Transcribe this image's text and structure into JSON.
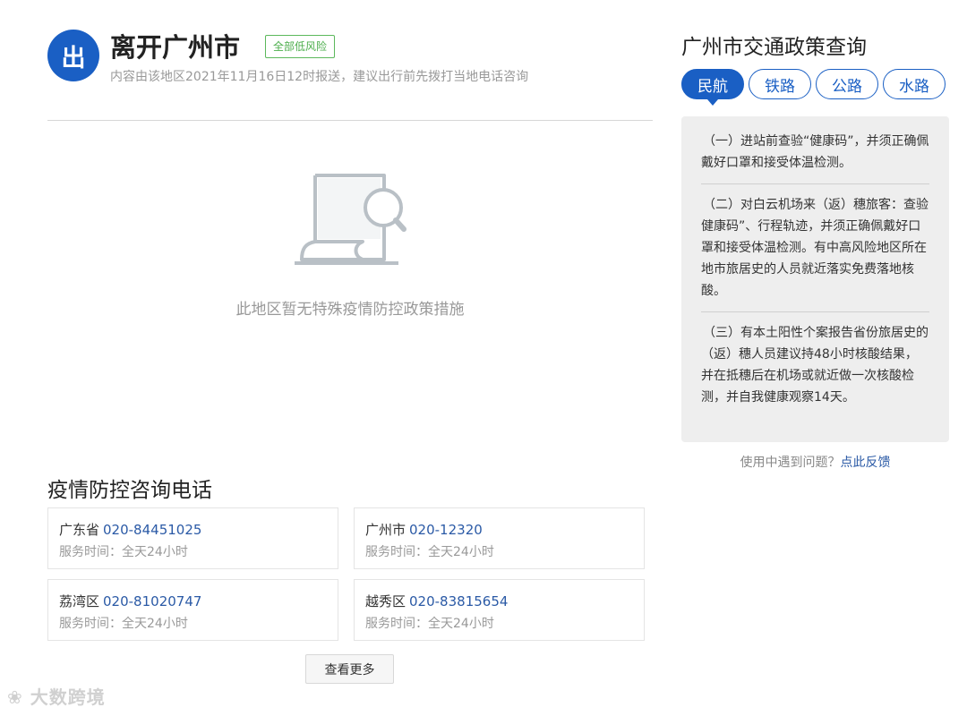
{
  "header": {
    "badge": "出",
    "title": "离开广州市",
    "risk_tag": "全部低风险",
    "subtitle": "内容由该地区2021年11月16日12时报送，建议出行前先拨打当地电话咨询"
  },
  "empty_state": {
    "icon": "document-search-icon",
    "text": "此地区暂无特殊疫情防控政策措施"
  },
  "hotline": {
    "title": "疫情防控咨询电话",
    "cards": [
      {
        "region": "广东省",
        "phone": "020-84451025",
        "hours": "服务时间：全天24小时"
      },
      {
        "region": "广州市",
        "phone": "020-12320",
        "hours": "服务时间：全天24小时"
      },
      {
        "region": "荔湾区",
        "phone": "020-81020747",
        "hours": "服务时间：全天24小时"
      },
      {
        "region": "越秀区",
        "phone": "020-83815654",
        "hours": "服务时间：全天24小时"
      }
    ],
    "more_label": "查看更多"
  },
  "policy": {
    "title": "广州市交通政策查询",
    "tabs": [
      "民航",
      "铁路",
      "公路",
      "水路"
    ],
    "active_tab": "民航",
    "items": [
      "（一）进站前查验“健康码”，并须正确佩戴好口罩和接受体温检测。",
      "（二）对白云机场来（返）穗旅客：查验健康码”、行程轨迹，并须正确佩戴好口罩和接受体温检测。有中高风险地区所在地市旅居史的人员就近落实免费落地核酸。",
      "（三）有本土阳性个案报告省份旅居史的（返）穗人员建议持48小时核酸结果，并在抵穗后在机场或就近做一次核酸检测，并自我健康观察14天。"
    ]
  },
  "feedback": {
    "prefix": "使用中遇到问题？",
    "link": "点此反馈"
  },
  "watermark": "大数跨境",
  "colors": {
    "brand_blue": "#1a5fc4",
    "risk_green": "#5cb85c",
    "link_blue": "#2b5aa6"
  }
}
